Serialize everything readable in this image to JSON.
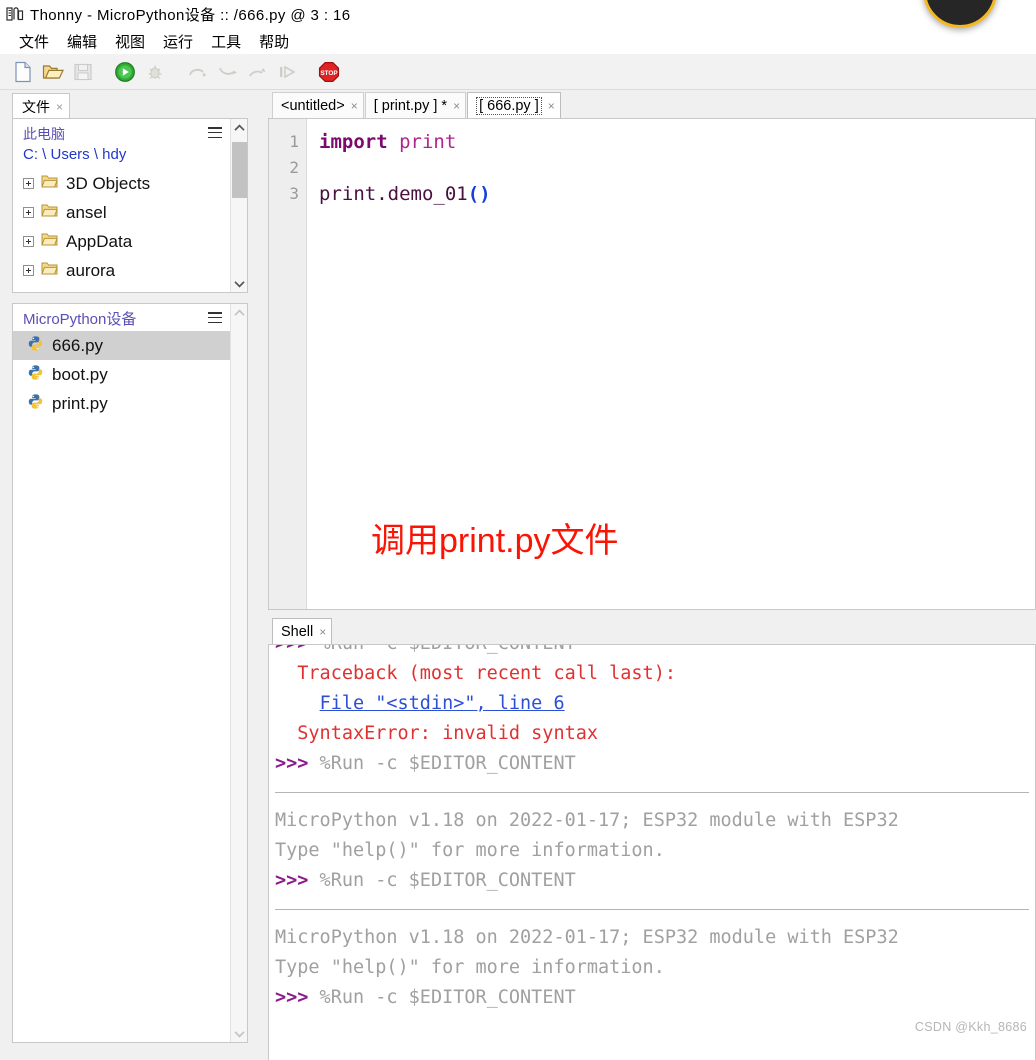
{
  "window": {
    "title": "Thonny  -  MicroPython设备 :: /666.py  @  3 : 16",
    "icon": "thonny-icon"
  },
  "menubar": {
    "items": [
      {
        "label": "文件",
        "name": "menu-file"
      },
      {
        "label": "编辑",
        "name": "menu-edit"
      },
      {
        "label": "视图",
        "name": "menu-view"
      },
      {
        "label": "运行",
        "name": "menu-run"
      },
      {
        "label": "工具",
        "name": "menu-tools"
      },
      {
        "label": "帮助",
        "name": "menu-help"
      }
    ]
  },
  "toolbar": {
    "buttons": [
      {
        "icon": "new-file-icon",
        "enabled": true
      },
      {
        "icon": "open-folder-icon",
        "enabled": true
      },
      {
        "icon": "save-icon",
        "enabled": false
      },
      {
        "icon": "run-icon",
        "enabled": true
      },
      {
        "icon": "debug-bug-icon",
        "enabled": false
      },
      {
        "icon": "step-over-icon",
        "enabled": false
      },
      {
        "icon": "step-into-icon",
        "enabled": false
      },
      {
        "icon": "step-out-icon",
        "enabled": false
      },
      {
        "icon": "resume-icon",
        "enabled": false
      },
      {
        "icon": "stop-icon",
        "enabled": true
      }
    ]
  },
  "sidebar": {
    "tab": {
      "label": "文件",
      "close": "×"
    },
    "local": {
      "title": "此电脑",
      "path": "C: \\ Users \\ hdy",
      "menu_icon": "hamburger-icon",
      "items": [
        {
          "label": "3D Objects",
          "icon": "folder-icon"
        },
        {
          "label": "ansel",
          "icon": "folder-icon"
        },
        {
          "label": "AppData",
          "icon": "folder-icon"
        },
        {
          "label": "aurora",
          "icon": "folder-icon"
        }
      ]
    },
    "device": {
      "title": "MicroPython设备",
      "menu_icon": "hamburger-icon",
      "items": [
        {
          "label": "666.py",
          "icon": "python-file-icon",
          "selected": true
        },
        {
          "label": "boot.py",
          "icon": "python-file-icon",
          "selected": false
        },
        {
          "label": "print.py",
          "icon": "python-file-icon",
          "selected": false
        }
      ]
    }
  },
  "editor": {
    "tabs": [
      {
        "label": "<untitled>",
        "active": false,
        "close": "×"
      },
      {
        "label": "[ print.py ] *",
        "active": false,
        "close": "×"
      },
      {
        "label": "[ 666.py ]",
        "active": true,
        "close": "×"
      }
    ],
    "line_numbers": [
      "1",
      "2",
      "3"
    ],
    "code": {
      "l1_kw": "import",
      "l1_mod": " print",
      "l3_name": "print.demo_01",
      "l3_paren": "()"
    },
    "annotation": "调用print.py文件",
    "annotation_color": "#fa1405"
  },
  "shell": {
    "tab": {
      "label": "Shell",
      "close": "×"
    },
    "lines": [
      {
        "type": "clipped_prompt",
        "prompt": ">>>",
        "text": " %Run -c $EDITOR_CONTENT"
      },
      {
        "type": "error",
        "text": "  Traceback (most recent call last):"
      },
      {
        "type": "link",
        "indent": "    ",
        "text": "File \"<stdin>\", line 6"
      },
      {
        "type": "error",
        "text": "  SyntaxError: invalid syntax"
      },
      {
        "type": "prompt",
        "prompt": ">>>",
        "text": " %Run -c $EDITOR_CONTENT"
      },
      {
        "type": "separator"
      },
      {
        "type": "output",
        "text": "MicroPython v1.18 on 2022-01-17; ESP32 module with ESP32"
      },
      {
        "type": "output",
        "text": "Type \"help()\" for more information."
      },
      {
        "type": "prompt",
        "prompt": ">>>",
        "text": " %Run -c $EDITOR_CONTENT"
      },
      {
        "type": "separator"
      },
      {
        "type": "output",
        "text": "MicroPython v1.18 on 2022-01-17; ESP32 module with ESP32"
      },
      {
        "type": "output",
        "text": "Type \"help()\" for more information."
      },
      {
        "type": "prompt",
        "prompt": ">>>",
        "text": " %Run -c $EDITOR_CONTENT"
      }
    ]
  },
  "watermark": "CSDN @Kkh_8686",
  "colors": {
    "accent_blue": "#2337c9",
    "device_title": "#5a50b4",
    "error_red": "#e03131",
    "prompt_purple": "#8c1a8c",
    "annotation_red": "#fa1405",
    "badge_ring": "#f5b820"
  }
}
